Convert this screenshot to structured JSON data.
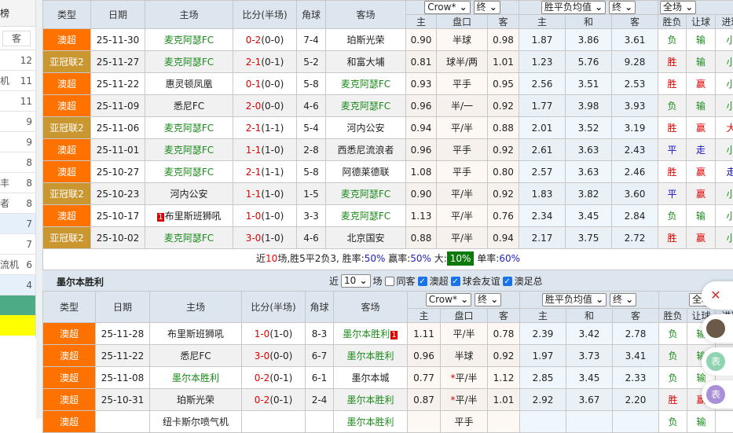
{
  "sidebar": {
    "header": "榜",
    "away_button": "客",
    "items": [
      {
        "label": "",
        "value": "12",
        "hl": false
      },
      {
        "label": "机",
        "value": "11",
        "hl": false
      },
      {
        "label": "",
        "value": "11",
        "hl": false
      },
      {
        "label": "",
        "value": "9",
        "hl": false
      },
      {
        "label": "",
        "value": "9",
        "hl": false
      },
      {
        "label": "",
        "value": "8",
        "hl": false
      },
      {
        "label": "丰",
        "value": "8",
        "hl": false
      },
      {
        "label": "者",
        "value": "8",
        "hl": false
      },
      {
        "label": "",
        "value": "7",
        "hl": true
      },
      {
        "label": "",
        "value": "7",
        "hl": false
      },
      {
        "label": "流机",
        "value": "6",
        "hl": false
      },
      {
        "label": "",
        "value": "4",
        "hl": true
      }
    ]
  },
  "colors": {
    "league_a_league": "#ff7200",
    "league_acl2": "#c9962f",
    "team_highlight": "#1a8a1a",
    "win": "#e00000",
    "lose": "#1a8a1a",
    "draw": "#1010c0"
  },
  "headers": {
    "type": "类型",
    "date": "日期",
    "home": "主场",
    "score": "比分(半场)",
    "corner": "角球",
    "away": "客场",
    "h": "主",
    "line": "盘口",
    "a": "客",
    "avg_h": "主",
    "avg_d": "和",
    "avg_a": "客",
    "result": "胜负",
    "handicap": "让球",
    "goals": "进球"
  },
  "selects": {
    "company": "Crow*",
    "stage": "终",
    "avg": "胜平负均值",
    "stage2": "终",
    "period": "全场"
  },
  "table1": {
    "rows": [
      {
        "league": "澳超",
        "lc": "o",
        "date": "25-11-30",
        "home": "麦克阿瑟FC",
        "hc": "grn",
        "ft": "0-2",
        "ht": "(0-0)",
        "corner": "7-4",
        "away": "珀斯光荣",
        "ac": "",
        "o1": "0.90",
        "line": "半球",
        "o2": "0.98",
        "w": "1.87",
        "d": "3.86",
        "l": "3.61",
        "res": "负",
        "rc": "grn",
        "hcp": "输",
        "pc": "grn",
        "goal": "小",
        "gc": "grn"
      },
      {
        "league": "亚冠联2",
        "lc": "g",
        "date": "25-11-27",
        "home": "麦克阿瑟FC",
        "hc": "grn",
        "ft": "2-1",
        "ht": "(0-1)",
        "corner": "5-2",
        "away": "和富大埔",
        "ac": "",
        "o1": "0.81",
        "line": "球半/两",
        "o2": "1.01",
        "w": "1.23",
        "d": "5.76",
        "l": "9.28",
        "res": "胜",
        "rc": "red",
        "hcp": "输",
        "pc": "grn",
        "goal": "小",
        "gc": "grn"
      },
      {
        "league": "澳超",
        "lc": "o",
        "date": "25-11-22",
        "home": "惠灵顿凤凰",
        "hc": "",
        "ft": "0-1",
        "ht": "(0-0)",
        "corner": "5-8",
        "away": "麦克阿瑟FC",
        "ac": "grn",
        "o1": "0.93",
        "line": "平手",
        "o2": "0.95",
        "w": "2.56",
        "d": "3.51",
        "l": "2.53",
        "res": "胜",
        "rc": "red",
        "hcp": "赢",
        "pc": "red",
        "goal": "小",
        "gc": "grn"
      },
      {
        "league": "澳超",
        "lc": "o",
        "date": "25-11-09",
        "home": "悉尼FC",
        "hc": "",
        "ft": "2-0",
        "ht": "(0-0)",
        "corner": "4-6",
        "away": "麦克阿瑟FC",
        "ac": "grn",
        "o1": "0.96",
        "line": "半/一",
        "o2": "0.92",
        "w": "1.77",
        "d": "3.98",
        "l": "3.93",
        "res": "负",
        "rc": "grn",
        "hcp": "输",
        "pc": "grn",
        "goal": "小",
        "gc": "grn"
      },
      {
        "league": "亚冠联2",
        "lc": "g",
        "date": "25-11-06",
        "home": "麦克阿瑟FC",
        "hc": "grn",
        "ft": "2-1",
        "ht": "(1-1)",
        "corner": "5-4",
        "away": "河内公安",
        "ac": "",
        "o1": "0.94",
        "line": "平/半",
        "o2": "0.88",
        "w": "2.01",
        "d": "3.52",
        "l": "3.19",
        "res": "胜",
        "rc": "red",
        "hcp": "赢",
        "pc": "red",
        "goal": "大",
        "gc": "red"
      },
      {
        "league": "澳超",
        "lc": "o",
        "date": "25-11-01",
        "home": "麦克阿瑟FC",
        "hc": "grn",
        "ft": "1-1",
        "ht": "(1-0)",
        "corner": "2-8",
        "away": "西悉尼流浪者",
        "ac": "",
        "o1": "0.96",
        "line": "平手",
        "o2": "0.92",
        "w": "2.61",
        "d": "3.63",
        "l": "2.43",
        "res": "平",
        "rc": "blu",
        "hcp": "走",
        "pc": "blu",
        "goal": "小",
        "gc": "grn"
      },
      {
        "league": "澳超",
        "lc": "o",
        "date": "25-10-27",
        "home": "麦克阿瑟FC",
        "hc": "grn",
        "ft": "2-1",
        "ht": "(1-1)",
        "corner": "5-8",
        "away": "阿德莱德联",
        "ac": "",
        "o1": "1.08",
        "line": "平手",
        "o2": "0.80",
        "w": "2.57",
        "d": "3.63",
        "l": "2.46",
        "res": "胜",
        "rc": "red",
        "hcp": "赢",
        "pc": "red",
        "goal": "走",
        "gc": "blu"
      },
      {
        "league": "亚冠联2",
        "lc": "g",
        "date": "25-10-23",
        "home": "河内公安",
        "hc": "",
        "ft": "1-1",
        "ht": "(1-0)",
        "corner": "1-5",
        "away": "麦克阿瑟FC",
        "ac": "grn",
        "o1": "0.90",
        "line": "平/半",
        "o2": "0.92",
        "w": "1.83",
        "d": "3.82",
        "l": "3.60",
        "res": "平",
        "rc": "blu",
        "hcp": "赢",
        "pc": "red",
        "goal": "小",
        "gc": "grn"
      },
      {
        "league": "澳超",
        "lc": "o",
        "date": "25-10-17",
        "home": "布里斯班狮吼",
        "hbadge": "1",
        "hc": "",
        "ft": "1-0",
        "ht": "(1-0)",
        "corner": "3-3",
        "away": "麦克阿瑟FC",
        "ac": "grn",
        "o1": "1.13",
        "line": "平/半",
        "o2": "0.76",
        "w": "2.34",
        "d": "3.45",
        "l": "2.84",
        "res": "负",
        "rc": "grn",
        "hcp": "输",
        "pc": "grn",
        "goal": "小",
        "gc": "grn"
      },
      {
        "league": "亚冠联2",
        "lc": "g",
        "date": "25-10-02",
        "home": "麦克阿瑟FC",
        "hc": "grn",
        "ft": "3-0",
        "ht": "(1-0)",
        "corner": "4-6",
        "away": "北京国安",
        "ac": "",
        "o1": "0.88",
        "line": "平/半",
        "o2": "0.94",
        "w": "2.17",
        "d": "3.75",
        "l": "2.72",
        "res": "胜",
        "rc": "red",
        "hcp": "赢",
        "pc": "red",
        "goal": "小",
        "gc": "grn"
      }
    ]
  },
  "summary": {
    "p1": "近",
    "n": "10",
    "p2": "场,胜5平2负3, 胜率:",
    "win_rate": "50%",
    "p3": " 赢率:",
    "hcp_rate": "50%",
    "p4": " 大:",
    "big_rate": "10%",
    "p5": " 单率:",
    "odd_rate": "60%"
  },
  "section2": {
    "title": "墨尔本胜利",
    "near": "近",
    "count": "10",
    "games": "场",
    "same_away": "同客",
    "f1": "澳超",
    "f2": "球会友谊",
    "f3": "澳足总"
  },
  "table2": {
    "rows": [
      {
        "league": "澳超",
        "lc": "o",
        "date": "25-11-28",
        "home": "布里斯班狮吼",
        "hc": "",
        "ft": "1-0",
        "ht": "(1-0)",
        "corner": "8-3",
        "away": "墨尔本胜利",
        "abadge": "1",
        "ac": "grn",
        "o1": "1.11",
        "line": "平/半",
        "o2": "0.78",
        "w": "2.39",
        "d": "3.42",
        "l": "2.78",
        "res": "负",
        "rc": "grn",
        "hcp": "输",
        "pc": "grn"
      },
      {
        "league": "澳超",
        "lc": "o",
        "date": "25-11-22",
        "home": "悉尼FC",
        "hc": "",
        "ft": "3-0",
        "ht": "(0-0)",
        "corner": "6-7",
        "away": "墨尔本胜利",
        "ac": "grn",
        "o1": "0.96",
        "line": "半球",
        "o2": "0.92",
        "w": "1.97",
        "d": "3.73",
        "l": "3.41",
        "res": "负",
        "rc": "grn",
        "hcp": "输",
        "pc": "grn"
      },
      {
        "league": "澳超",
        "lc": "o",
        "date": "25-11-08",
        "home": "墨尔本胜利",
        "hc": "grn",
        "ft": "0-2",
        "ht": "(0-1)",
        "corner": "6-1",
        "away": "墨尔本城",
        "ac": "",
        "o1": "0.77",
        "star": "*",
        "line": "平/半",
        "o2": "1.12",
        "w": "2.85",
        "d": "3.45",
        "l": "2.33",
        "res": "负",
        "rc": "grn",
        "hcp": "输",
        "pc": "grn"
      },
      {
        "league": "澳超",
        "lc": "o",
        "date": "25-10-31",
        "home": "珀斯光荣",
        "hc": "",
        "ft": "0-2",
        "ht": "(0-1)",
        "corner": "2-4",
        "away": "墨尔本胜利",
        "ac": "grn",
        "o1": "0.87",
        "star": "*",
        "line": "平/半",
        "o2": "1.01",
        "w": "2.92",
        "d": "3.67",
        "l": "2.20",
        "res": "胜",
        "rc": "red",
        "hcp": "赢",
        "pc": "red"
      },
      {
        "league": "澳超",
        "lc": "o",
        "date": "",
        "home": "纽卡斯尔喷气机",
        "hc": "",
        "ft": "",
        "ht": "",
        "corner": "",
        "away": "墨尔本胜利",
        "ac": "grn",
        "o1": "",
        "line": "平手",
        "o2": "",
        "w": "",
        "d": "",
        "l": "",
        "res": "负",
        "rc": "grn",
        "hcp": "输",
        "pc": "grn"
      }
    ]
  },
  "float": [
    {
      "icon": "close-x-icon",
      "label": "",
      "color": "#ffffff"
    },
    {
      "icon": "avatar-photo",
      "label": "",
      "color": "#6b5a48"
    },
    {
      "icon": "avatar",
      "label": "表",
      "color": "#8fd3b0"
    },
    {
      "icon": "avatar",
      "label": "表",
      "color": "#a98fd8"
    }
  ]
}
